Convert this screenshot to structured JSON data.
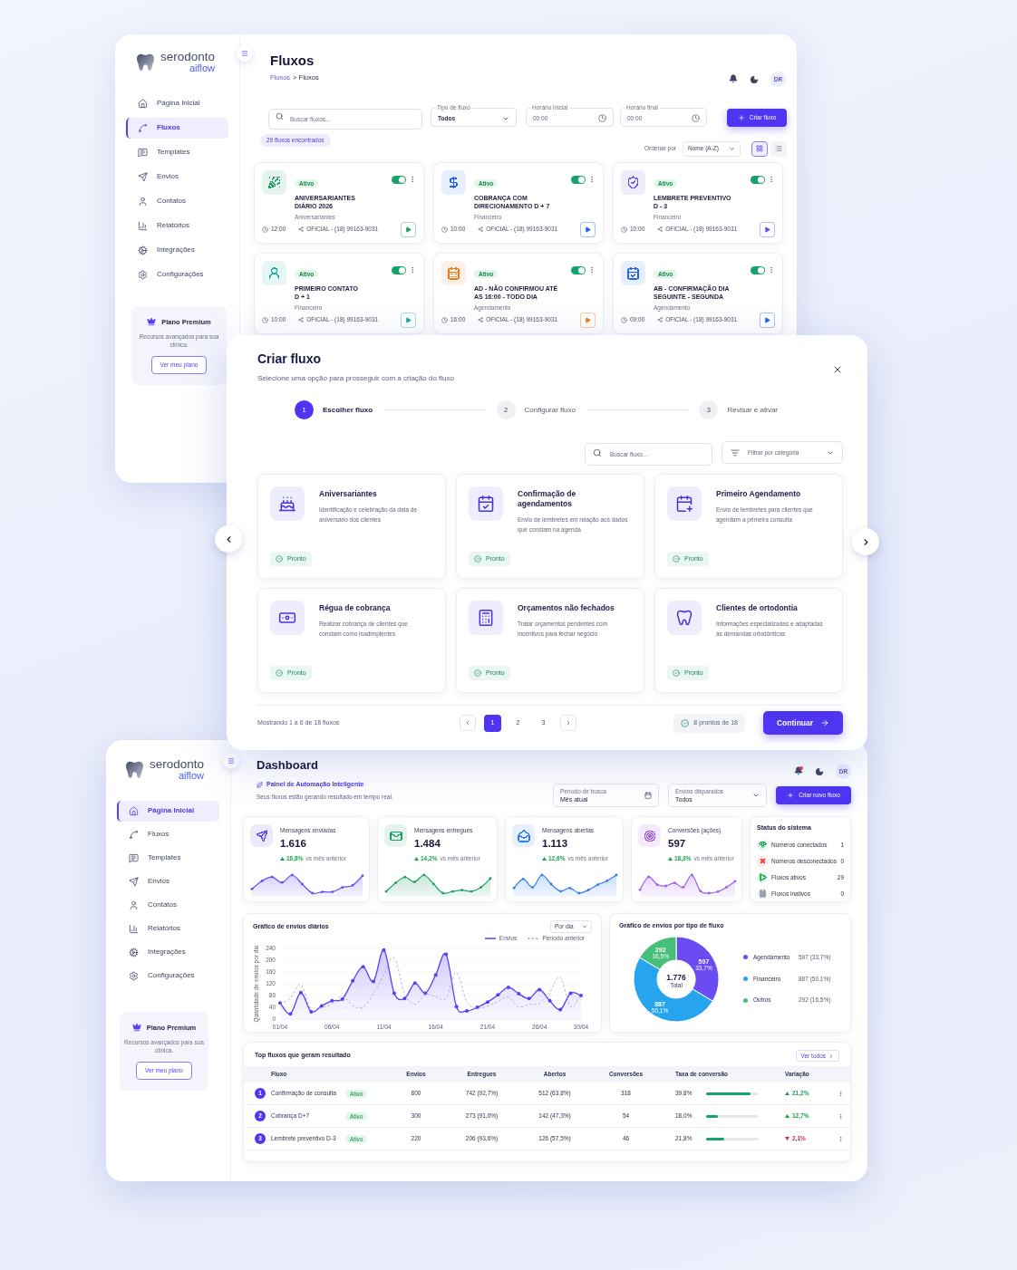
{
  "fluxos_page": {
    "brand": {
      "name": "serodonto",
      "product": "aiflow"
    },
    "sidebar": {
      "items": [
        {
          "label": "Página Inicial",
          "selected": false
        },
        {
          "label": "Fluxos",
          "selected": true
        },
        {
          "label": "Templates",
          "selected": false
        },
        {
          "label": "Envios",
          "selected": false
        },
        {
          "label": "Contatos",
          "selected": false
        },
        {
          "label": "Relatórios",
          "selected": false
        },
        {
          "label": "Integrações",
          "selected": false
        },
        {
          "label": "Configurações",
          "selected": false
        }
      ],
      "plan": {
        "title": "Plano Premium",
        "text": "Recursos avançados para sua clínica.",
        "button": "Ver meu plano"
      }
    },
    "header": {
      "title": "Fluxos",
      "breadcrumb": {
        "link": "Fluxos",
        "text": "> Fluxos"
      },
      "unread_notifications": false,
      "avatar": "DR"
    },
    "filters": {
      "search": {
        "placeholder": "Buscar fluxos..."
      },
      "fields": [
        {
          "kind": "select",
          "label": "Tipo de fluxo",
          "value": "Todos"
        },
        {
          "kind": "time",
          "label": "Horário inicial",
          "value": "00:00"
        },
        {
          "kind": "time",
          "label": "Horário final",
          "value": "00:00"
        }
      ],
      "create_button": "Criar fluxo"
    },
    "results": "29 fluxos encontrados",
    "sort": {
      "label": "Ordenar por",
      "value": "Nome (A-Z)"
    },
    "view_modes": [
      {
        "kind": "grid",
        "selected": true
      },
      {
        "kind": "list",
        "selected": false
      }
    ],
    "cards": [
      {
        "status": "Ativo",
        "title": [
          "ANIVERSARIANTES",
          "DIÁRIO 2026"
        ],
        "category": "Aniversariantes",
        "time": "12:00",
        "channel": "OFICIAL - (18) 99163-9031",
        "on": true,
        "color": "#1f9d63"
      },
      {
        "status": "Ativo",
        "title": [
          "COBRANÇA COM",
          "DIRECIONAMENTO D + 7"
        ],
        "category": "Financeiro",
        "time": "10:00",
        "channel": "OFICIAL - (18) 99163-9031",
        "on": true,
        "color": "#2563eb"
      },
      {
        "status": "Ativo",
        "title": [
          "LEMBRETE PREVENTIVO",
          "D - 3"
        ],
        "category": "Financeiro",
        "time": "10:00",
        "channel": "OFICIAL - (18) 99163-9031",
        "on": true,
        "color": "#6d4ef2"
      },
      {
        "status": "Ativo",
        "title": [
          "PRIMEIRO CONTATO",
          "D + 1"
        ],
        "category": "Financeiro",
        "time": "10:00",
        "channel": "OFICIAL - (18) 99163-9031",
        "on": true,
        "color": "#1fae98"
      },
      {
        "status": "Ativo",
        "title": [
          "AD - NÃO CONFIRMOU ATÉ",
          "AS 16:00 - TODO DIA"
        ],
        "category": "Agendamento",
        "time": "16:00",
        "channel": "OFICIAL - (18) 99163-9031",
        "on": true,
        "color": "#f07a1a"
      },
      {
        "status": "Ativo",
        "title": [
          "AB - CONFIRMAÇÃO DIA",
          "SEGUINTE - SEGUNDA"
        ],
        "category": "Agendamento",
        "time": "09:00",
        "channel": "OFICIAL - (18) 99163-9031",
        "on": true,
        "color": "#2563eb"
      }
    ]
  },
  "create_modal": {
    "title": "Criar fluxo",
    "subtitle": "Selecione uma opção para prosseguir com a criação do fluxo",
    "steps": [
      {
        "number": "1",
        "label": "Escolher fluxo",
        "active": true
      },
      {
        "number": "2",
        "label": "Configurar fluxo",
        "active": false
      },
      {
        "number": "3",
        "label": "Revisar e ativar",
        "active": false
      }
    ],
    "search": {
      "placeholder": "Buscar fluxo..."
    },
    "category_filter": {
      "placeholder": "Filtrar por categoria"
    },
    "templates": [
      {
        "title": "Aniversariantes",
        "description": "Identificação e celebração da data de aniversário dos clientes",
        "status": "Pronto"
      },
      {
        "title": "Confirmação de agendamentos",
        "description": "Envio de lembretes em relação aos dados que constam na agenda",
        "status": "Pronto"
      },
      {
        "title": "Primeiro Agendamento",
        "description": "Envio de lembretes para clientes que agendam a primeira consulta",
        "status": "Pronto"
      },
      {
        "title": "Régua de cobrança",
        "description": "Realizar cobrança de clientes que constam como inadimplentes",
        "status": "Pronto"
      },
      {
        "title": "Orçamentos não fechados",
        "description": "Tratar orçamentos pendentes com incentivos para fechar negócio",
        "status": "Pronto"
      },
      {
        "title": "Clientes de ortodontia",
        "description": "Informações especializadas e adaptadas às demandas ortodônticas",
        "status": "Pronto"
      }
    ],
    "footer": {
      "showing": "Mostrando 1 a 6 de 18 fluxos",
      "pages": [
        {
          "label": "1",
          "selected": true
        },
        {
          "label": "2",
          "selected": false
        },
        {
          "label": "3",
          "selected": false
        }
      ],
      "ready": "8 prontos de 18",
      "continue_button": "Continuar"
    }
  },
  "dashboard": {
    "brand": {
      "name": "serodonto",
      "product": "aiflow"
    },
    "sidebar": {
      "items": [
        {
          "label": "Página Inicial",
          "selected": true
        },
        {
          "label": "Fluxos",
          "selected": false
        },
        {
          "label": "Templates",
          "selected": false
        },
        {
          "label": "Envios",
          "selected": false
        },
        {
          "label": "Contatos",
          "selected": false
        },
        {
          "label": "Relatórios",
          "selected": false
        },
        {
          "label": "Integrações",
          "selected": false
        },
        {
          "label": "Configurações",
          "selected": false
        }
      ],
      "plan": {
        "title": "Plano Premium",
        "text": "Recursos avançados para sua clínica.",
        "button": "Ver meu plano"
      }
    },
    "header": {
      "title": "Dashboard",
      "subtitle": "Painel de Automação Inteligente",
      "description": "Seus fluxos estão gerando resultado em tempo real.",
      "unread_notifications": true,
      "avatar": "DR",
      "period": {
        "label": "Período de busca",
        "value": "Mês atual"
      },
      "sent_filter": {
        "label": "Envios disparados",
        "value": "Todos"
      },
      "create_button": "Criar novo fluxo"
    },
    "stats": [
      {
        "label": "Mensagens enviadas",
        "value": "1.616",
        "change": "16,8%",
        "rising": true,
        "comparison": "vs mês anterior",
        "color": "#6a4cf2"
      },
      {
        "label": "Mensagens entregues",
        "value": "1.484",
        "change": "14,2%",
        "rising": true,
        "comparison": "vs mês anterior",
        "color": "#1f9d63"
      },
      {
        "label": "Mensagens abertas",
        "value": "1.113",
        "change": "12,6%",
        "rising": true,
        "comparison": "vs mês anterior",
        "color": "#2f7cf0"
      },
      {
        "label": "Conversões (ações)",
        "value": "597",
        "change": "18,3%",
        "rising": true,
        "comparison": "vs mês anterior",
        "color": "#9b5cf0"
      }
    ],
    "system_status": {
      "title": "Status do sistema",
      "items": [
        {
          "label": "Números conectados",
          "value": "1",
          "color": "#22b35e"
        },
        {
          "label": "Números desconectados",
          "value": "0",
          "color": "#ef4444"
        },
        {
          "label": "Fluxos ativos",
          "value": "29",
          "color": "#22b35e"
        },
        {
          "label": "Fluxos inativos",
          "value": "0",
          "color": "#9ca3af"
        }
      ]
    },
    "daily_chart": {
      "period_select": "Por dia",
      "chart_data": {
        "type": "line",
        "title": "Gráfico de envios diários",
        "ylabel": "Quantidade de envios por dia",
        "grid": true,
        "categories": [
          "01/04",
          null,
          null,
          null,
          null,
          "06/04",
          null,
          null,
          null,
          null,
          "11/04",
          null,
          null,
          null,
          null,
          "16/04",
          null,
          null,
          null,
          null,
          "21/04",
          null,
          null,
          null,
          null,
          "26/04",
          null,
          null,
          null,
          "30/04"
        ],
        "yticks": [
          0,
          40,
          80,
          120,
          160,
          200,
          240
        ],
        "ylim": [
          0,
          240
        ],
        "series": [
          {
            "name": "Envios",
            "color": "#5b3df5",
            "type": "area",
            "line_style": "solid",
            "values": [
              55,
              18,
              90,
              25,
              45,
              62,
              68,
              130,
              178,
              128,
              235,
              88,
              70,
              122,
              88,
              150,
              220,
              42,
              28,
              40,
              58,
              82,
              108,
              86,
              70,
              100,
              62,
              32,
              88,
              80
            ]
          },
          {
            "name": "Período anterior",
            "color": "#a3a8bd",
            "type": "line",
            "line_style": "dashed",
            "values": [
              50,
              72,
              117,
              32,
              38,
              52,
              78,
              46,
              40,
              86,
              150,
              208,
              88,
              50,
              84,
              76,
              72,
              158,
              58,
              38,
              44,
              60,
              74,
              42,
              50,
              54,
              92,
              142,
              42,
              84
            ]
          }
        ]
      }
    },
    "type_chart": {
      "title": "Gráfico de envios por tipo de fluxo",
      "center_value": "1.776",
      "center_label": "Total",
      "chart_data": {
        "type": "donut",
        "categories": [
          "Agendamento",
          "Financeiro",
          "Outros"
        ],
        "values": [
          597,
          887,
          292
        ],
        "data_labels": true
      },
      "slice_percents": [
        "33,7%",
        "50,1%",
        "16,5%"
      ],
      "legend": [
        {
          "value": "597 (33,7%)",
          "color": "#6a4cf2"
        },
        {
          "value": "887 (50,1%)",
          "color": "#27a4ee"
        },
        {
          "value": "292 (16,5%)",
          "color": "#47bf78"
        }
      ]
    },
    "top_flows": {
      "title": "Top fluxos que geram resultado",
      "view_all": "Ver todos",
      "columns": [
        "Fluxo",
        "Envios",
        "Entregues",
        "Abertos",
        "Conversões",
        "Taxa de conversão",
        "Variação"
      ],
      "rows": [
        {
          "rank": "1",
          "name": "Confirmação de consulta",
          "status": "Ativo",
          "sent": "800",
          "delivered": "742 (92,7%)",
          "opened": "512 (63,8%)",
          "conversions": "318",
          "rate": "39,8%",
          "level": 0.85,
          "change": "21,2%",
          "rising": true
        },
        {
          "rank": "2",
          "name": "Cobrança D+7",
          "status": "Ativo",
          "sent": "300",
          "delivered": "273 (91,0%)",
          "opened": "142 (47,3%)",
          "conversions": "54",
          "rate": "18,0%",
          "level": 0.22,
          "change": "12,7%",
          "rising": true
        },
        {
          "rank": "3",
          "name": "Lembrete preventivo D-3",
          "status": "Ativo",
          "sent": "220",
          "delivered": "206 (93,6%)",
          "opened": "126 (57,5%)",
          "conversions": "46",
          "rate": "21,8%",
          "level": 0.34,
          "change": "2,1%",
          "rising": false
        }
      ]
    }
  }
}
